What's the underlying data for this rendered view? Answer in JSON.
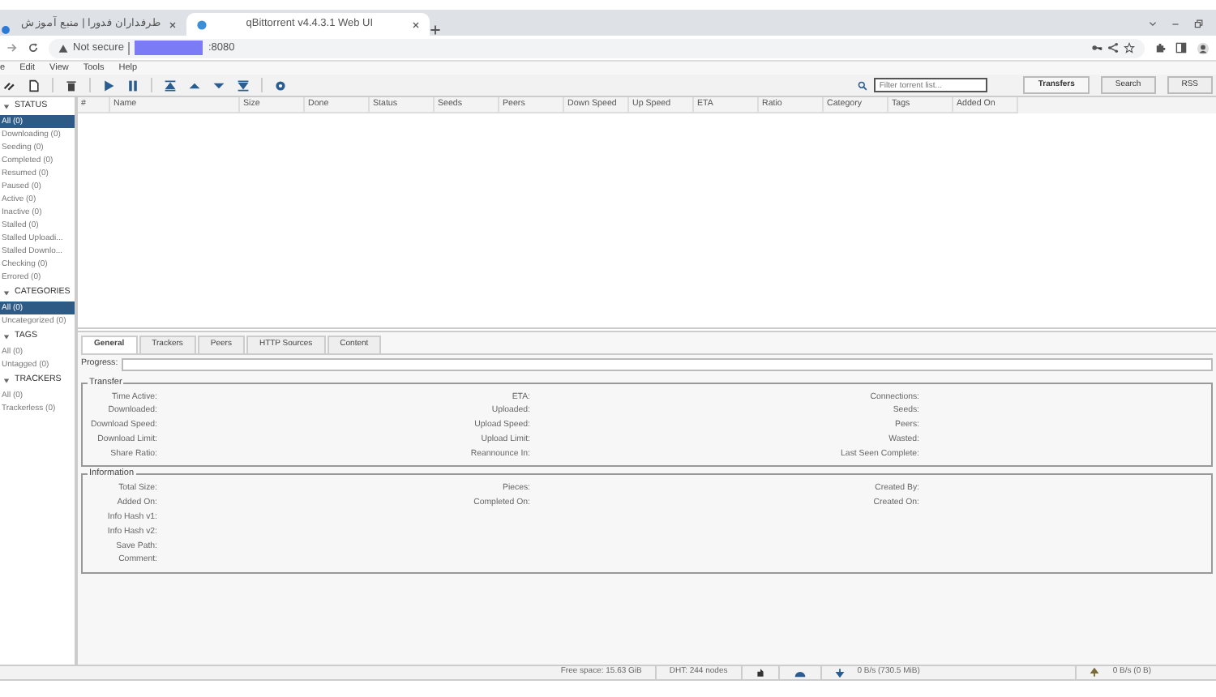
{
  "browser": {
    "tabs": [
      {
        "title": "طرفداران فدورا | منبع آموزش",
        "selected": false
      },
      {
        "title": "qBittorrent v4.4.3.1 Web UI",
        "selected": true
      }
    ],
    "address": {
      "security": "Not secure",
      "text": ":8080"
    }
  },
  "menu": [
    "e",
    "Edit",
    "View",
    "Tools",
    "Help"
  ],
  "search": {
    "placeholder": "Filter torrent list..."
  },
  "view_tabs": [
    {
      "label": "Transfers",
      "selected": true
    },
    {
      "label": "Search",
      "selected": false
    },
    {
      "label": "RSS",
      "selected": false
    }
  ],
  "table": {
    "columns": [
      "#",
      "Name",
      "Size",
      "Done",
      "Status",
      "Seeds",
      "Peers",
      "Down Speed",
      "Up Speed",
      "ETA",
      "Ratio",
      "Category",
      "Tags",
      "Added On"
    ]
  },
  "sidebar": [
    {
      "title": "STATUS",
      "items": [
        {
          "label": "All (0)",
          "selected": true
        },
        {
          "label": "Downloading (0)",
          "selected": false
        },
        {
          "label": "Seeding (0)",
          "selected": false
        },
        {
          "label": "Completed (0)",
          "selected": false
        },
        {
          "label": "Resumed (0)",
          "selected": false
        },
        {
          "label": "Paused (0)",
          "selected": false
        },
        {
          "label": "Active (0)",
          "selected": false
        },
        {
          "label": "Inactive (0)",
          "selected": false
        },
        {
          "label": "Stalled (0)",
          "selected": false
        },
        {
          "label": "Stalled Uploadi...",
          "selected": false
        },
        {
          "label": "Stalled Downlo...",
          "selected": false
        },
        {
          "label": "Checking (0)",
          "selected": false
        },
        {
          "label": "Errored (0)",
          "selected": false
        }
      ]
    },
    {
      "title": "CATEGORIES",
      "items": [
        {
          "label": "All (0)",
          "selected": true
        },
        {
          "label": "Uncategorized (0)",
          "selected": false
        }
      ]
    },
    {
      "title": "TAGS",
      "items": [
        {
          "label": "All (0)",
          "selected": false
        },
        {
          "label": "Untagged (0)",
          "selected": false
        }
      ]
    },
    {
      "title": "TRACKERS",
      "items": [
        {
          "label": "All (0)",
          "selected": false
        },
        {
          "label": "Trackerless (0)",
          "selected": false
        }
      ]
    }
  ],
  "details": {
    "tabs": [
      {
        "label": "General",
        "selected": true
      },
      {
        "label": "Trackers",
        "selected": false
      },
      {
        "label": "Peers",
        "selected": false
      },
      {
        "label": "HTTP Sources",
        "selected": false
      },
      {
        "label": "Content",
        "selected": false
      }
    ],
    "progress": {
      "label": "Progress:",
      "level": 0
    },
    "groups": [
      {
        "title": "Transfer",
        "columns": [
          [
            "Time Active:",
            "Downloaded:",
            "Download Speed:",
            "Download Limit:",
            "Share Ratio:"
          ],
          [
            "ETA:",
            "Uploaded:",
            "Upload Speed:",
            "Upload Limit:",
            "Reannounce In:"
          ],
          [
            "Connections:",
            "Seeds:",
            "Peers:",
            "Wasted:",
            "Last Seen Complete:"
          ]
        ]
      },
      {
        "title": "Information",
        "columns": [
          [
            "Total Size:",
            "Added On:",
            "Info Hash v1:",
            "Info Hash v2:",
            "Save Path:",
            "Comment:"
          ],
          [
            "Pieces:",
            "Completed On:"
          ],
          [
            "Created By:",
            "Created On:"
          ]
        ]
      }
    ]
  },
  "status_bar": {
    "free_space": "Free space: 15.63 GiB",
    "dht": "DHT: 244 nodes",
    "download": "0 B/s (730.5 MiB)",
    "upload": "0 B/s (0 B)"
  }
}
